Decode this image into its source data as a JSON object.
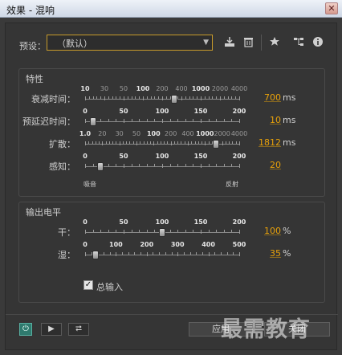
{
  "window": {
    "title": "效果 - 混响",
    "close_glyph": "✕"
  },
  "preset": {
    "label": "预设：",
    "value": "（默认）"
  },
  "toolbar": [
    "save-preset-icon",
    "delete-icon",
    "favorite-icon",
    "routing-icon",
    "info-icon"
  ],
  "characteristics": {
    "title": "特性",
    "params": [
      {
        "label": "衰减时间：",
        "ticks": [
          "10",
          "30",
          "50",
          "100",
          "200",
          "400",
          "1000",
          "2000",
          "4000"
        ],
        "value": "700",
        "unit": "ms",
        "fraction": 0.58
      },
      {
        "label": "预延迟时间：",
        "ticks": [
          "0",
          "50",
          "100",
          "150",
          "200"
        ],
        "value": "10",
        "unit": "ms",
        "fraction": 0.05
      },
      {
        "label": "扩散：",
        "ticks": [
          "1.0",
          "20",
          "30",
          "50",
          "100",
          "200",
          "400",
          "1000",
          "2000",
          "4000"
        ],
        "value": "1812",
        "unit": "ms",
        "fraction": 0.85
      },
      {
        "label": "感知：",
        "ticks": [
          "0",
          "50",
          "100",
          "150",
          "200"
        ],
        "value": "20",
        "unit": "",
        "fraction": 0.1
      }
    ],
    "perception_left": "吸音",
    "perception_right": "反射"
  },
  "output": {
    "title": "输出电平",
    "params": [
      {
        "label": "干：",
        "ticks": [
          "0",
          "50",
          "100",
          "150",
          "200"
        ],
        "value": "100",
        "unit": "%",
        "fraction": 0.5
      },
      {
        "label": "湿：",
        "ticks": [
          "0",
          "100",
          "200",
          "300",
          "400",
          "500"
        ],
        "value": "35",
        "unit": "%",
        "fraction": 0.07
      }
    ],
    "sum_input": {
      "label": "总输入",
      "checked": true,
      "glyph": "✓"
    }
  },
  "footer": {
    "apply_label": "应用",
    "close_label": "关闭",
    "play_glyph": "▶",
    "loop_glyph": "⮂",
    "power_glyph": "⏻"
  },
  "watermark": "最需教育"
}
